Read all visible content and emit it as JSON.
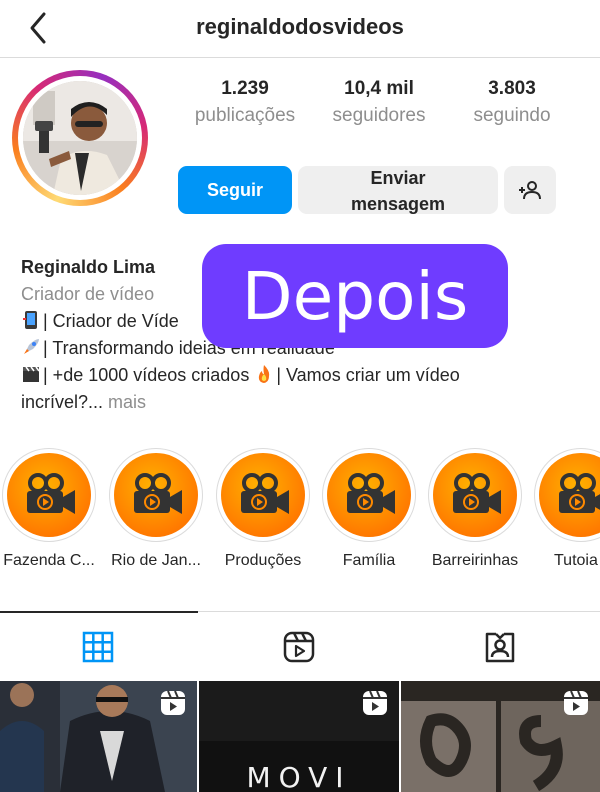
{
  "header": {
    "username": "reginaldodosvideos"
  },
  "stats": [
    {
      "value": "1.239",
      "label": "publicações"
    },
    {
      "value": "10,4 mil",
      "label": "seguidores"
    },
    {
      "value": "3.803",
      "label": "seguindo"
    }
  ],
  "actions": {
    "follow": "Seguir",
    "message_line1": "Enviar",
    "message_line2": "mensagem"
  },
  "bio": {
    "name": "Reginaldo Lima",
    "category": "Criador de vídeo",
    "line1": "| Criador de Víde",
    "line2": "| Transformando ideias em realidade",
    "line3a": "| +de 1000 vídeos criados ",
    "line3b": "| Vamos criar um vídeo",
    "line4": "incrível?...",
    "more": "mais"
  },
  "overlay": {
    "text": "Depois"
  },
  "highlights": [
    {
      "label": "Fazenda C..."
    },
    {
      "label": "Rio de Jan..."
    },
    {
      "label": "Produções"
    },
    {
      "label": "Família"
    },
    {
      "label": "Barreirinhas"
    },
    {
      "label": "Tutoia"
    }
  ],
  "grid": [
    {
      "caption": ""
    },
    {
      "caption": "MOVI"
    },
    {
      "caption": ""
    }
  ],
  "colors": {
    "accent": "#0095f6",
    "overlay": "#6f3cff",
    "highlight": "#ff8a00"
  },
  "icons": [
    "back-arrow-icon",
    "add-person-icon",
    "grid-icon",
    "reels-icon",
    "tagged-icon",
    "movie-camera-icon",
    "reel-badge-icon"
  ]
}
